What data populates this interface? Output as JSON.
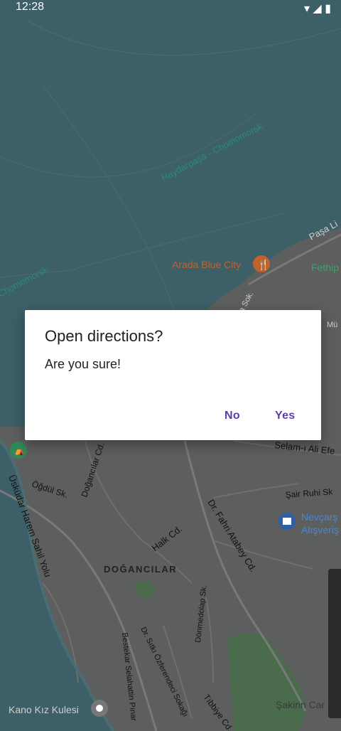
{
  "status_bar": {
    "time": "12:28"
  },
  "dialog": {
    "title": "Open directions?",
    "message": "Are you sure!",
    "no_label": "No",
    "yes_label": "Yes"
  },
  "map": {
    "labels": {
      "haydarpasa_route": "Haydarpaşa - Chomomorsk",
      "chomomorsk_route": "Chomomorsk",
      "paşa": "Paşa Li",
      "arada": "Arada Blue City",
      "fethi": "Fethip",
      "sok": "a Sok.",
      "mu": "Mü",
      "selami": "Selam-ı Ali Efe",
      "sair": "Şair Ruhi Sk",
      "uskudar": "Üsküdar Harem Sahil Yolu",
      "ogdul": "Öğdül Sk.",
      "dogancilar_cd": "Doğancılar Cd.",
      "fahri": "Dr. Fahri Atabey Cd.",
      "halk": "Halk Cd.",
      "nevcarsi1": "Nevçarş",
      "nevcarsi2": "Alışveriş",
      "dogancilar": "DOĞANCILAR",
      "donmedolap": "Dönmedolap Sk.",
      "bestekar": "Bestekar Selahattin Pınar",
      "sitki": "Dr. Sıtkı Özferendeci Sokağı",
      "tibbiye": "Tıbbiye Cd.",
      "sakirin": "Şakirin Car",
      "kano": "Kano Kız Kulesi"
    },
    "colors": {
      "water": "#3d5f68",
      "land": "#5d5f5e",
      "road": "#777a79",
      "park": "#4b6b4d",
      "label_road": "#1e1e1e",
      "label_poi_orange": "#c0632a",
      "label_poi_blue": "#2e5fa8",
      "label_green": "#3fa06a"
    }
  }
}
